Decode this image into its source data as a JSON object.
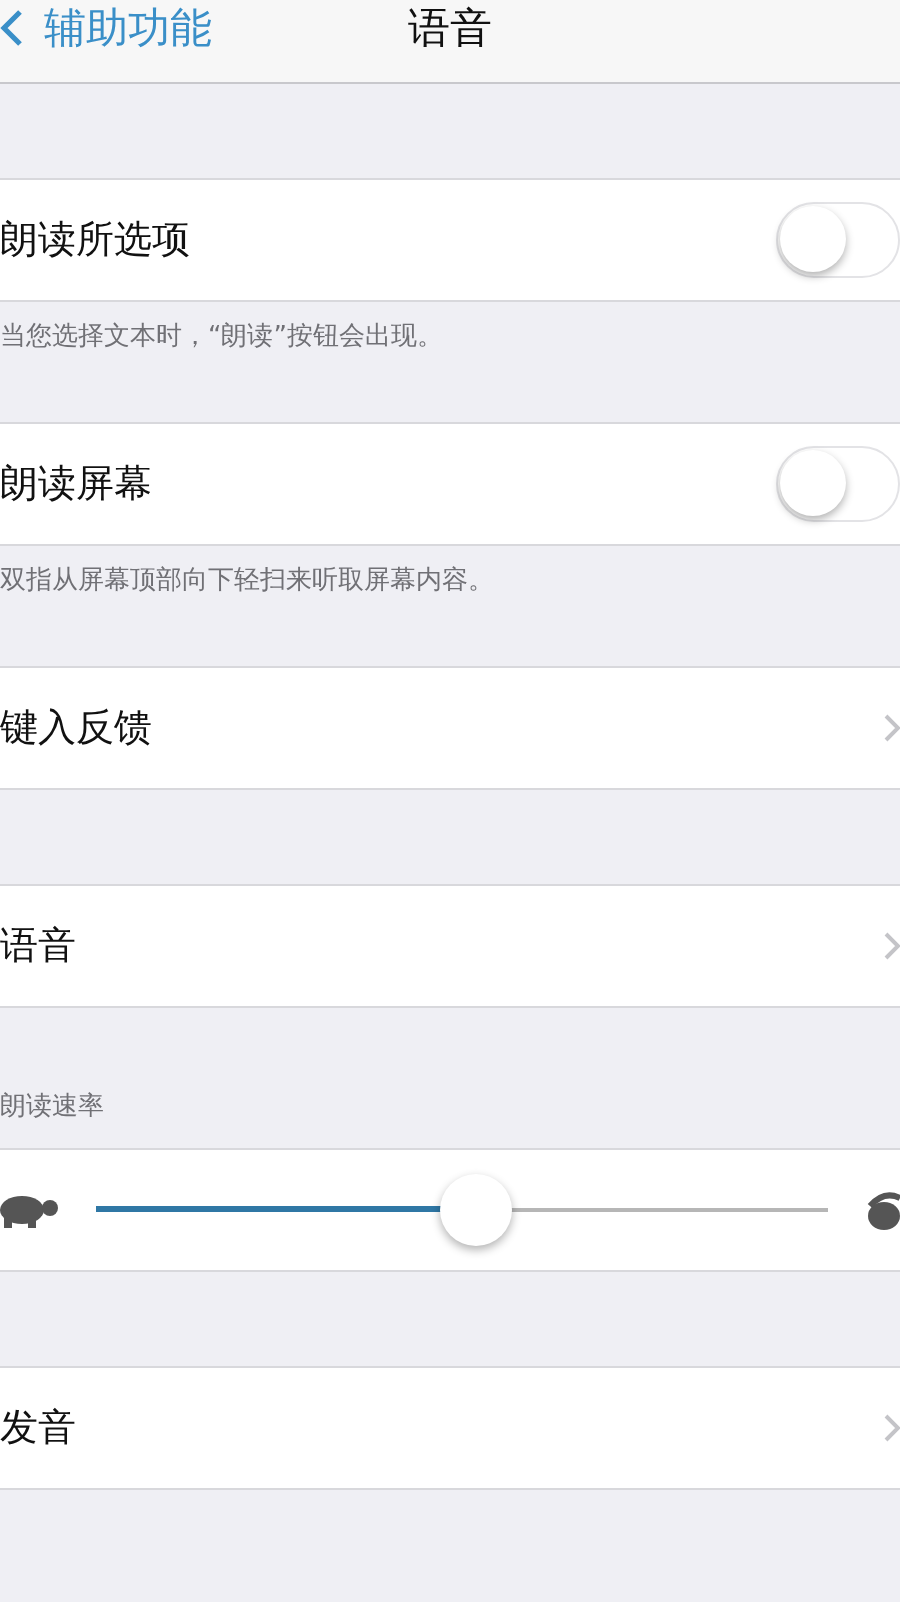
{
  "nav": {
    "back": "辅助功能",
    "title": "语音"
  },
  "sections": [
    {
      "kind": "toggle",
      "label": "朗读所选项",
      "on": false,
      "footer": "当您选择文本时，“朗读”按钮会出现。"
    },
    {
      "kind": "toggle",
      "label": "朗读屏幕",
      "on": false,
      "footer": "双指从屏幕顶部向下轻扫来听取屏幕内容。"
    },
    {
      "kind": "link",
      "label": "键入反馈"
    },
    {
      "kind": "link",
      "label": "语音"
    },
    {
      "kind": "slider",
      "header": "朗读速率",
      "level": 0.52
    },
    {
      "kind": "link",
      "label": "发音"
    }
  ]
}
